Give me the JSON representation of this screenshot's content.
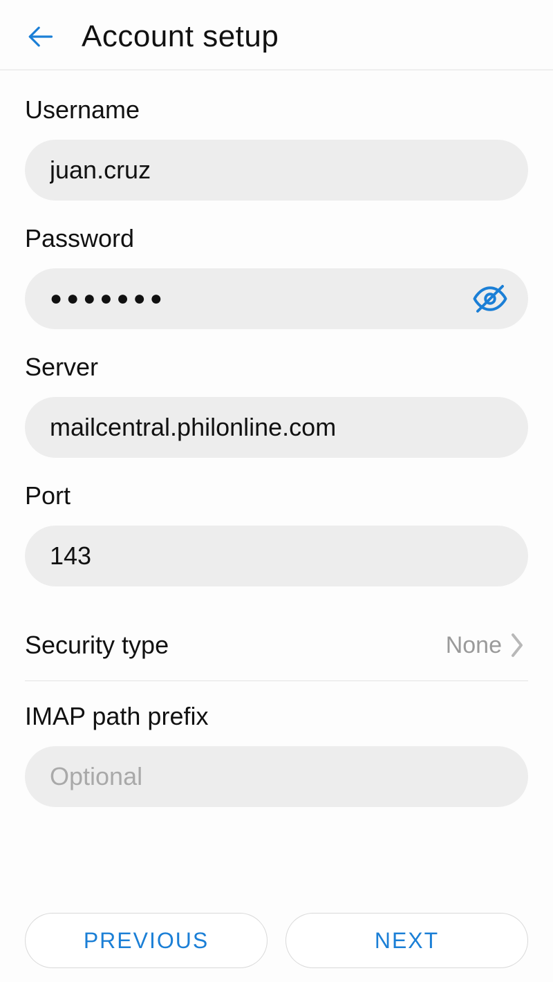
{
  "header": {
    "title": "Account setup"
  },
  "form": {
    "username": {
      "label": "Username",
      "value": "juan.cruz"
    },
    "password": {
      "label": "Password",
      "mask": "●●●●●●●"
    },
    "server": {
      "label": "Server",
      "value": "mailcentral.philonline.com"
    },
    "port": {
      "label": "Port",
      "value": "143"
    },
    "security": {
      "label": "Security type",
      "value": "None"
    },
    "imap_prefix": {
      "label": "IMAP path prefix",
      "placeholder": "Optional",
      "value": ""
    }
  },
  "footer": {
    "previous": "PREVIOUS",
    "next": "NEXT"
  },
  "icons": {
    "back": "back-arrow-icon",
    "eye": "eye-off-icon",
    "chevron": "chevron-right-icon"
  }
}
